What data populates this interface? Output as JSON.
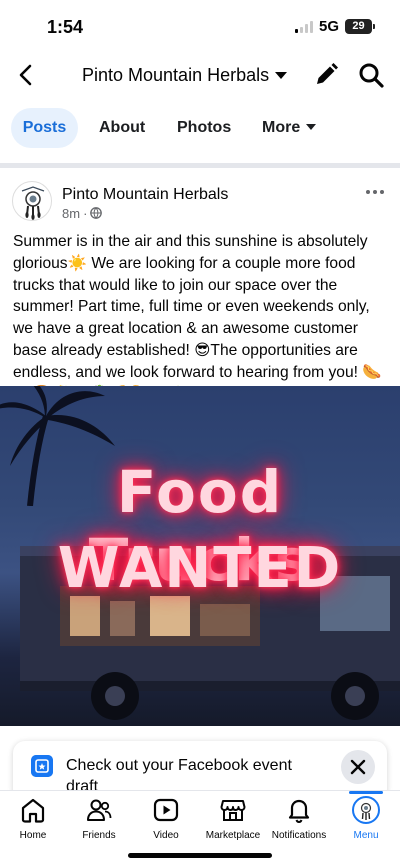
{
  "status_bar": {
    "time": "1:54",
    "network": "5G",
    "battery": "29"
  },
  "header": {
    "title": "Pinto Mountain Herbals",
    "icons": [
      "back-icon",
      "chevron-down-icon",
      "pencil-icon",
      "search-icon"
    ]
  },
  "tabs": [
    {
      "label": "Posts",
      "active": true
    },
    {
      "label": "About",
      "active": false
    },
    {
      "label": "Photos",
      "active": false
    },
    {
      "label": "More",
      "active": false
    }
  ],
  "post": {
    "author": "Pinto Mountain Herbals",
    "time": "8m",
    "audience_icon": "globe-icon",
    "text": "Summer is in the air and this sunshine is absolutely glorious☀️ We are looking for a couple more food trucks that would like to join our space over the summer! Part time, full time or even weekends only, we have a great location & an awesome customer base already established! 😎The opportunities are endless, and we look forward to hearing from you! 🌭🌮🍔🍟🧆🥙🍕🌯🍱🧁🍩",
    "image_text_line1": "Food Trucks",
    "image_text_line2": "WANTED"
  },
  "event_banner": {
    "text": "Check out your Facebook event draft",
    "icon": "calendar-star-icon",
    "close_icon": "close-icon"
  },
  "bottom_nav": [
    {
      "label": "Home",
      "icon": "home-icon"
    },
    {
      "label": "Friends",
      "icon": "friends-icon"
    },
    {
      "label": "Video",
      "icon": "video-icon"
    },
    {
      "label": "Marketplace",
      "icon": "marketplace-icon"
    },
    {
      "label": "Notifications",
      "icon": "bell-icon"
    },
    {
      "label": "Menu",
      "icon": "profile-avatar",
      "active": true
    }
  ],
  "colors": {
    "accent": "#1877f2",
    "active_tab_bg": "#e7f1fd",
    "neon": "#ff1744"
  }
}
